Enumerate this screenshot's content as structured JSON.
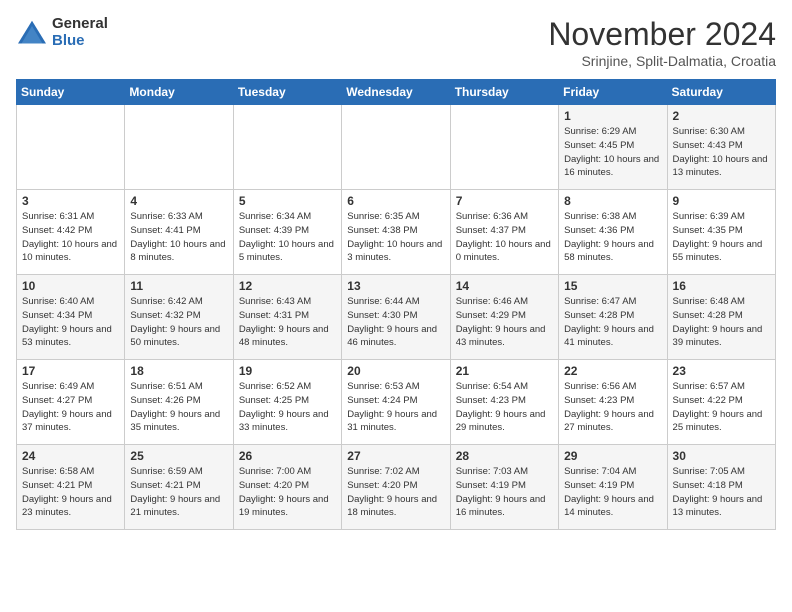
{
  "header": {
    "logo_general": "General",
    "logo_blue": "Blue",
    "month_title": "November 2024",
    "location": "Srinjine, Split-Dalmatia, Croatia"
  },
  "days_of_week": [
    "Sunday",
    "Monday",
    "Tuesday",
    "Wednesday",
    "Thursday",
    "Friday",
    "Saturday"
  ],
  "weeks": [
    [
      {
        "day": "",
        "info": ""
      },
      {
        "day": "",
        "info": ""
      },
      {
        "day": "",
        "info": ""
      },
      {
        "day": "",
        "info": ""
      },
      {
        "day": "",
        "info": ""
      },
      {
        "day": "1",
        "info": "Sunrise: 6:29 AM\nSunset: 4:45 PM\nDaylight: 10 hours and 16 minutes."
      },
      {
        "day": "2",
        "info": "Sunrise: 6:30 AM\nSunset: 4:43 PM\nDaylight: 10 hours and 13 minutes."
      }
    ],
    [
      {
        "day": "3",
        "info": "Sunrise: 6:31 AM\nSunset: 4:42 PM\nDaylight: 10 hours and 10 minutes."
      },
      {
        "day": "4",
        "info": "Sunrise: 6:33 AM\nSunset: 4:41 PM\nDaylight: 10 hours and 8 minutes."
      },
      {
        "day": "5",
        "info": "Sunrise: 6:34 AM\nSunset: 4:39 PM\nDaylight: 10 hours and 5 minutes."
      },
      {
        "day": "6",
        "info": "Sunrise: 6:35 AM\nSunset: 4:38 PM\nDaylight: 10 hours and 3 minutes."
      },
      {
        "day": "7",
        "info": "Sunrise: 6:36 AM\nSunset: 4:37 PM\nDaylight: 10 hours and 0 minutes."
      },
      {
        "day": "8",
        "info": "Sunrise: 6:38 AM\nSunset: 4:36 PM\nDaylight: 9 hours and 58 minutes."
      },
      {
        "day": "9",
        "info": "Sunrise: 6:39 AM\nSunset: 4:35 PM\nDaylight: 9 hours and 55 minutes."
      }
    ],
    [
      {
        "day": "10",
        "info": "Sunrise: 6:40 AM\nSunset: 4:34 PM\nDaylight: 9 hours and 53 minutes."
      },
      {
        "day": "11",
        "info": "Sunrise: 6:42 AM\nSunset: 4:32 PM\nDaylight: 9 hours and 50 minutes."
      },
      {
        "day": "12",
        "info": "Sunrise: 6:43 AM\nSunset: 4:31 PM\nDaylight: 9 hours and 48 minutes."
      },
      {
        "day": "13",
        "info": "Sunrise: 6:44 AM\nSunset: 4:30 PM\nDaylight: 9 hours and 46 minutes."
      },
      {
        "day": "14",
        "info": "Sunrise: 6:46 AM\nSunset: 4:29 PM\nDaylight: 9 hours and 43 minutes."
      },
      {
        "day": "15",
        "info": "Sunrise: 6:47 AM\nSunset: 4:28 PM\nDaylight: 9 hours and 41 minutes."
      },
      {
        "day": "16",
        "info": "Sunrise: 6:48 AM\nSunset: 4:28 PM\nDaylight: 9 hours and 39 minutes."
      }
    ],
    [
      {
        "day": "17",
        "info": "Sunrise: 6:49 AM\nSunset: 4:27 PM\nDaylight: 9 hours and 37 minutes."
      },
      {
        "day": "18",
        "info": "Sunrise: 6:51 AM\nSunset: 4:26 PM\nDaylight: 9 hours and 35 minutes."
      },
      {
        "day": "19",
        "info": "Sunrise: 6:52 AM\nSunset: 4:25 PM\nDaylight: 9 hours and 33 minutes."
      },
      {
        "day": "20",
        "info": "Sunrise: 6:53 AM\nSunset: 4:24 PM\nDaylight: 9 hours and 31 minutes."
      },
      {
        "day": "21",
        "info": "Sunrise: 6:54 AM\nSunset: 4:23 PM\nDaylight: 9 hours and 29 minutes."
      },
      {
        "day": "22",
        "info": "Sunrise: 6:56 AM\nSunset: 4:23 PM\nDaylight: 9 hours and 27 minutes."
      },
      {
        "day": "23",
        "info": "Sunrise: 6:57 AM\nSunset: 4:22 PM\nDaylight: 9 hours and 25 minutes."
      }
    ],
    [
      {
        "day": "24",
        "info": "Sunrise: 6:58 AM\nSunset: 4:21 PM\nDaylight: 9 hours and 23 minutes."
      },
      {
        "day": "25",
        "info": "Sunrise: 6:59 AM\nSunset: 4:21 PM\nDaylight: 9 hours and 21 minutes."
      },
      {
        "day": "26",
        "info": "Sunrise: 7:00 AM\nSunset: 4:20 PM\nDaylight: 9 hours and 19 minutes."
      },
      {
        "day": "27",
        "info": "Sunrise: 7:02 AM\nSunset: 4:20 PM\nDaylight: 9 hours and 18 minutes."
      },
      {
        "day": "28",
        "info": "Sunrise: 7:03 AM\nSunset: 4:19 PM\nDaylight: 9 hours and 16 minutes."
      },
      {
        "day": "29",
        "info": "Sunrise: 7:04 AM\nSunset: 4:19 PM\nDaylight: 9 hours and 14 minutes."
      },
      {
        "day": "30",
        "info": "Sunrise: 7:05 AM\nSunset: 4:18 PM\nDaylight: 9 hours and 13 minutes."
      }
    ]
  ]
}
